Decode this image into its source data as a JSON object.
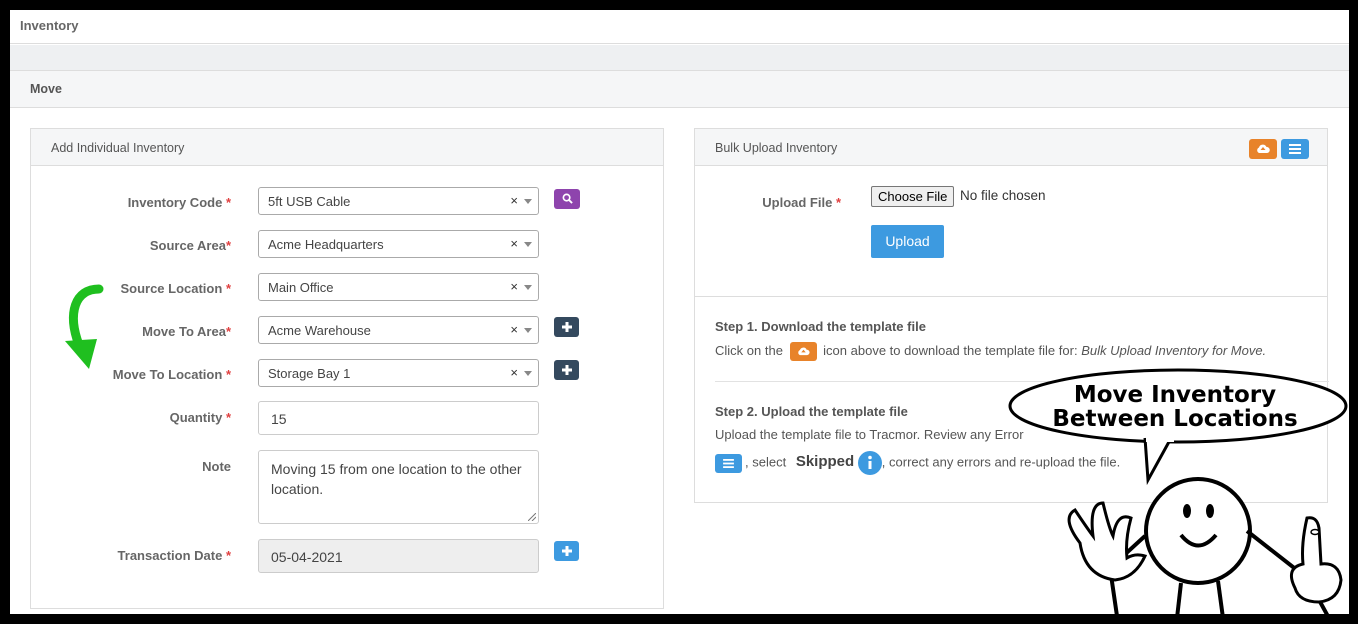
{
  "app": {
    "title": "Inventory"
  },
  "section": {
    "title": "Move"
  },
  "individual": {
    "title": "Add Individual Inventory",
    "fields": {
      "inventory_code": {
        "label": "Inventory Code",
        "value": "5ft USB Cable",
        "clear": "×"
      },
      "source_area": {
        "label": "Source Area",
        "value": "Acme Headquarters",
        "clear": "×"
      },
      "source_location": {
        "label": "Source Location",
        "value": "Main Office",
        "clear": "×"
      },
      "move_to_area": {
        "label": "Move To Area",
        "value": "Acme Warehouse",
        "clear": "×"
      },
      "move_to_location": {
        "label": "Move To Location",
        "value": "Storage Bay 1",
        "clear": "×"
      },
      "quantity": {
        "label": "Quantity",
        "value": "15"
      },
      "note": {
        "label": "Note",
        "value": "Moving 15 from one location to the other location."
      },
      "transaction_date": {
        "label": "Transaction Date",
        "value": "05-04-2021"
      }
    },
    "required_mark": "*"
  },
  "bulk": {
    "title": "Bulk Upload Inventory",
    "upload_label": "Upload File",
    "choose_file": "Choose File",
    "no_file": "No file chosen",
    "upload_button": "Upload",
    "step1_title": "Step 1. Download the template file",
    "step1_pre": "Click on the",
    "step1_mid": "icon above to download the template file for:",
    "step1_em": "Bulk Upload Inventory for Move.",
    "step2_title": "Step 2. Upload the template file",
    "step2_line1": "Upload the template file to Tracmor. Review any Error",
    "step2_pre": ", select",
    "step2_skipped": "Skipped",
    "step2_post": ", correct any errors and re-upload the file."
  },
  "callout": {
    "line1": "Move Inventory",
    "line2": "Between Locations"
  },
  "colors": {
    "orange": "#e8832a",
    "blue": "#3d9ae0",
    "purple": "#8e44ad",
    "dark": "#34495e",
    "arrow": "#1fbf1f"
  },
  "icons": {
    "search": "search-icon",
    "plus": "plus-icon",
    "cloud": "cloud-upload-icon",
    "list": "list-icon",
    "info": "info-icon"
  }
}
